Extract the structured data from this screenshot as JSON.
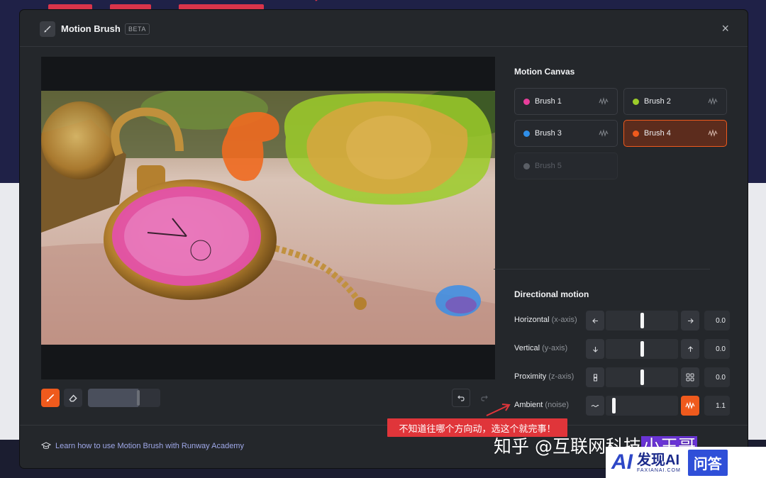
{
  "modal": {
    "title": "Motion Brush",
    "badge": "BETA",
    "close_glyph": "×"
  },
  "motion_canvas": {
    "title": "Motion Canvas",
    "brushes": [
      {
        "name": "Brush 1",
        "color": "#e83e9b",
        "state": "normal"
      },
      {
        "name": "Brush 2",
        "color": "#9ccd2a",
        "state": "normal"
      },
      {
        "name": "Brush 3",
        "color": "#2f8ee8",
        "state": "normal"
      },
      {
        "name": "Brush 4",
        "color": "#ef5a1d",
        "state": "active"
      },
      {
        "name": "Brush 5",
        "color": "#5a5e65",
        "state": "disabled"
      }
    ]
  },
  "directional_motion": {
    "title": "Directional motion",
    "rows": [
      {
        "label": "Horizontal",
        "sub": "(x-axis)",
        "value": "0.0",
        "level": 0.5,
        "left_icon": "arrow-left-icon",
        "right_icon": "arrow-right-icon"
      },
      {
        "label": "Vertical",
        "sub": "(y-axis)",
        "value": "0.0",
        "level": 0.5,
        "left_icon": "arrow-down-icon",
        "right_icon": "arrow-up-icon"
      },
      {
        "label": "Proximity",
        "sub": "(z-axis)",
        "value": "0.0",
        "level": 0.5,
        "left_icon": "shrink-icon",
        "right_icon": "expand-icon"
      },
      {
        "label": "Ambient",
        "sub": "(noise)",
        "value": "1.1",
        "level": 0.11,
        "left_icon": "noise-wave-icon",
        "right_icon": "ambient-wave-icon"
      }
    ]
  },
  "toolbar": {
    "brush_size_level": 0.7
  },
  "footer": {
    "learn_link": "Learn how to use Motion Brush with Runway Academy"
  },
  "annotation": {
    "text": "不知道往哪个方向动，选这个就完事！"
  },
  "watermarks": {
    "zhihu_prefix": "知乎 @互联网科技",
    "zhihu_highlight": "小王哥",
    "badge_main": "发现AI",
    "badge_small": "FAXIANAI.COM",
    "badge_qa": "问答"
  },
  "colors": {
    "accent": "#ef5a1d",
    "panel": "#24272b",
    "link": "#9fa8e8"
  }
}
